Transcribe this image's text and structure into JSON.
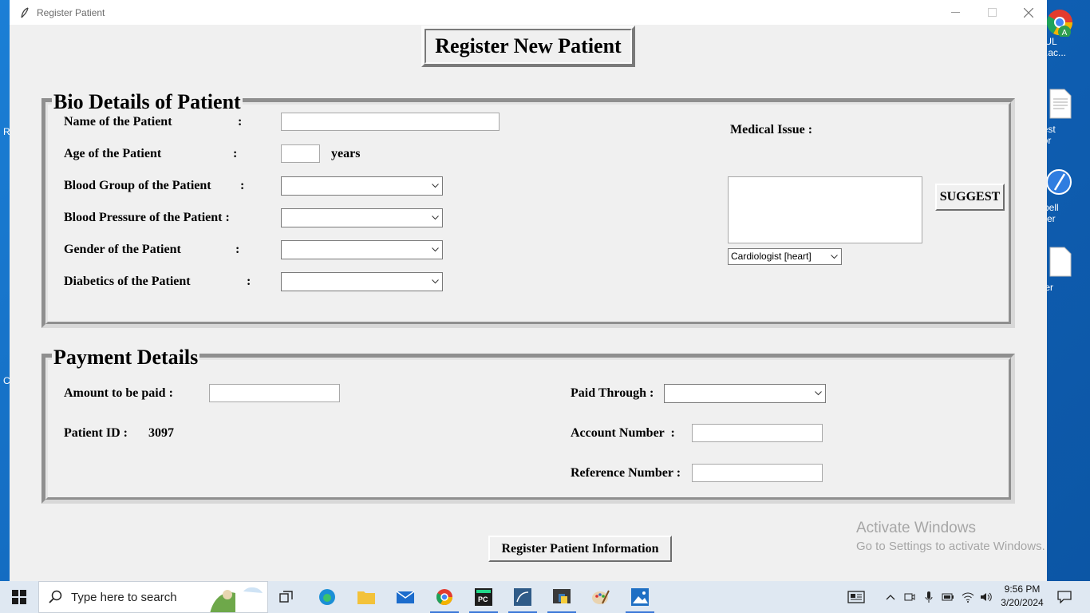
{
  "window": {
    "title": "Register Patient",
    "heading": "Register New Patient"
  },
  "bio": {
    "title": "Bio Details of Patient",
    "name_label": "Name of the Patient",
    "age_label": "Age of the Patient",
    "age_unit": "years",
    "blood_group_label": "Blood Group of the Patient",
    "blood_pressure_label": "Blood Pressure of the Patient :",
    "gender_label": "Gender of the Patient",
    "diabetics_label": "Diabetics of the Patient",
    "colon": ":",
    "name_value": "",
    "age_value": "",
    "blood_group_value": "",
    "blood_pressure_value": "",
    "gender_value": "",
    "diabetics_value": "",
    "medical_issue_label": "Medical Issue :",
    "medical_issue_value": "",
    "suggest_button": "SUGGEST",
    "specialist_value": "Cardiologist [heart]"
  },
  "payment": {
    "title": "Payment Details",
    "amount_label": "Amount to be paid :",
    "amount_value": "",
    "patient_id_label": "Patient ID :",
    "patient_id_value": "3097",
    "paid_through_label": "Paid Through :",
    "paid_through_value": "",
    "account_label": "Account Number  :",
    "account_value": "",
    "reference_label": "Reference Number :",
    "reference_value": ""
  },
  "register_button": "Register Patient Information",
  "watermark": {
    "line1": "Activate Windows",
    "line2": "Go to Settings to activate Windows."
  },
  "desktop_icons": [
    "OUL\ntu.ac...",
    "gest\nttor",
    "Spell\ncker",
    "yter"
  ],
  "taskbar": {
    "search_placeholder": "Type here to search",
    "time": "9:56 PM",
    "date": "3/20/2024"
  },
  "colors": {
    "window_bg": "#f0f0f0",
    "desktop_bg": "#1570c8",
    "taskbar_bg": "#dfe8f2"
  }
}
